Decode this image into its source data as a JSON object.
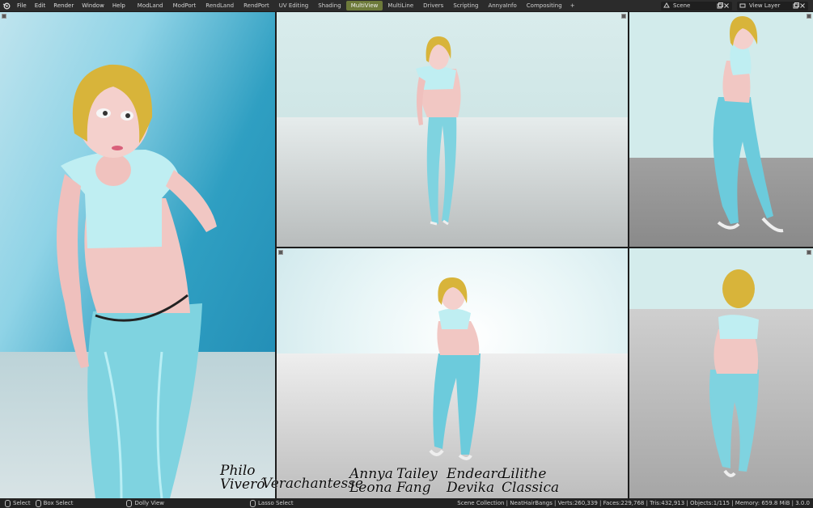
{
  "topbar": {
    "menus": [
      "File",
      "Edit",
      "Render",
      "Window",
      "Help"
    ],
    "workspaces": [
      "ModLand",
      "ModPort",
      "RendLand",
      "RendPort",
      "UV Editing",
      "Shading",
      "MultiView",
      "MultiLine",
      "Drivers",
      "Scripting",
      "AnnyaInfo",
      "Compositing"
    ],
    "active_workspace": "MultiView",
    "add_label": "+",
    "scene_label": "Scene",
    "view_layer_label": "View Layer"
  },
  "statusbar": {
    "select": "Select",
    "box_select": "Box Select",
    "dolly_view": "Dolly View",
    "lasso_select": "Lasso Select",
    "stats": "Scene Collection | NeatHairBangs | Verts:260,339 | Faces:229,768 | Tris:432,913 | Objects:1/115 | Memory: 659.8 MiB | 3.0.0"
  },
  "signatures": [
    {
      "line1": "Philo",
      "line2": "Viveró"
    },
    {
      "line1": "Verachantesse",
      "line2": ""
    },
    {
      "line1": "Annya",
      "line2": "Leona"
    },
    {
      "line1": "Tailey",
      "line2": "Fang"
    },
    {
      "line1": "Endearo",
      "line2": "Devika"
    },
    {
      "line1": "Lilithe",
      "line2": "Classica"
    }
  ],
  "colors": {
    "accent_active_tab": "#6d7a3a",
    "hair": "#d8b43a",
    "top": "#a8e4ea",
    "leggings": "#6ccbdc"
  }
}
